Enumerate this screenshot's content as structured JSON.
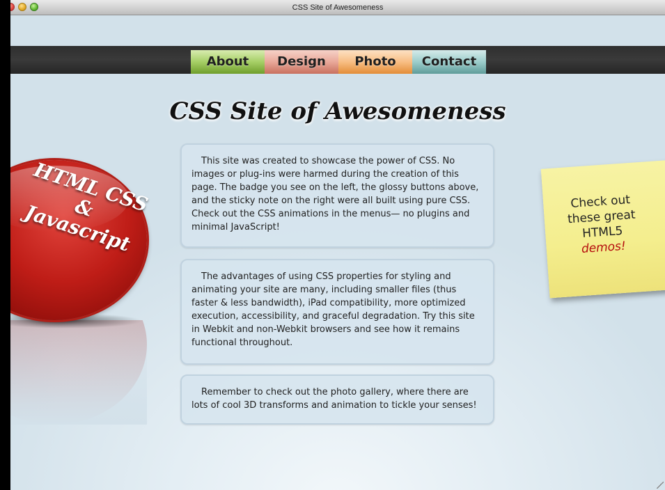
{
  "window": {
    "title": "CSS Site of Awesomeness"
  },
  "nav": {
    "items": [
      {
        "label": "About",
        "color": "#8cbf4c"
      },
      {
        "label": "Design",
        "color": "#e3937f"
      },
      {
        "label": "Photo",
        "color": "#f7b26a"
      },
      {
        "label": "Contact",
        "color": "#86bebc"
      }
    ]
  },
  "page": {
    "title": "CSS Site of Awesomeness",
    "paragraphs": [
      "This site was created to showcase the power of CSS. No images or plug-ins were harmed during the creation of this page. The badge you see on the left, the glossy buttons above, and the sticky note on the right were all built using pure CSS. Check out the CSS animations in the menus— no plugins and minimal JavaScript!",
      "The advantages of using CSS properties for styling and animating your site are many, including smaller files (thus faster & less bandwidth), iPad compatibility, more optimized execution, accessibility, and graceful degradation. Try this site in Webkit and non-Webkit browsers and see how it remains functional throughout.",
      "Remember to check out the photo gallery, where there are lots of cool 3D transforms and animation to tickle your senses!"
    ]
  },
  "badge": {
    "line1": "HTML CSS",
    "line2": "&",
    "line3": "Javascript",
    "color": "#c0201a"
  },
  "sticky": {
    "line1": "Check out",
    "line2": "these great",
    "line3": "HTML5",
    "link": "demos!",
    "color": "#f5ef92"
  }
}
